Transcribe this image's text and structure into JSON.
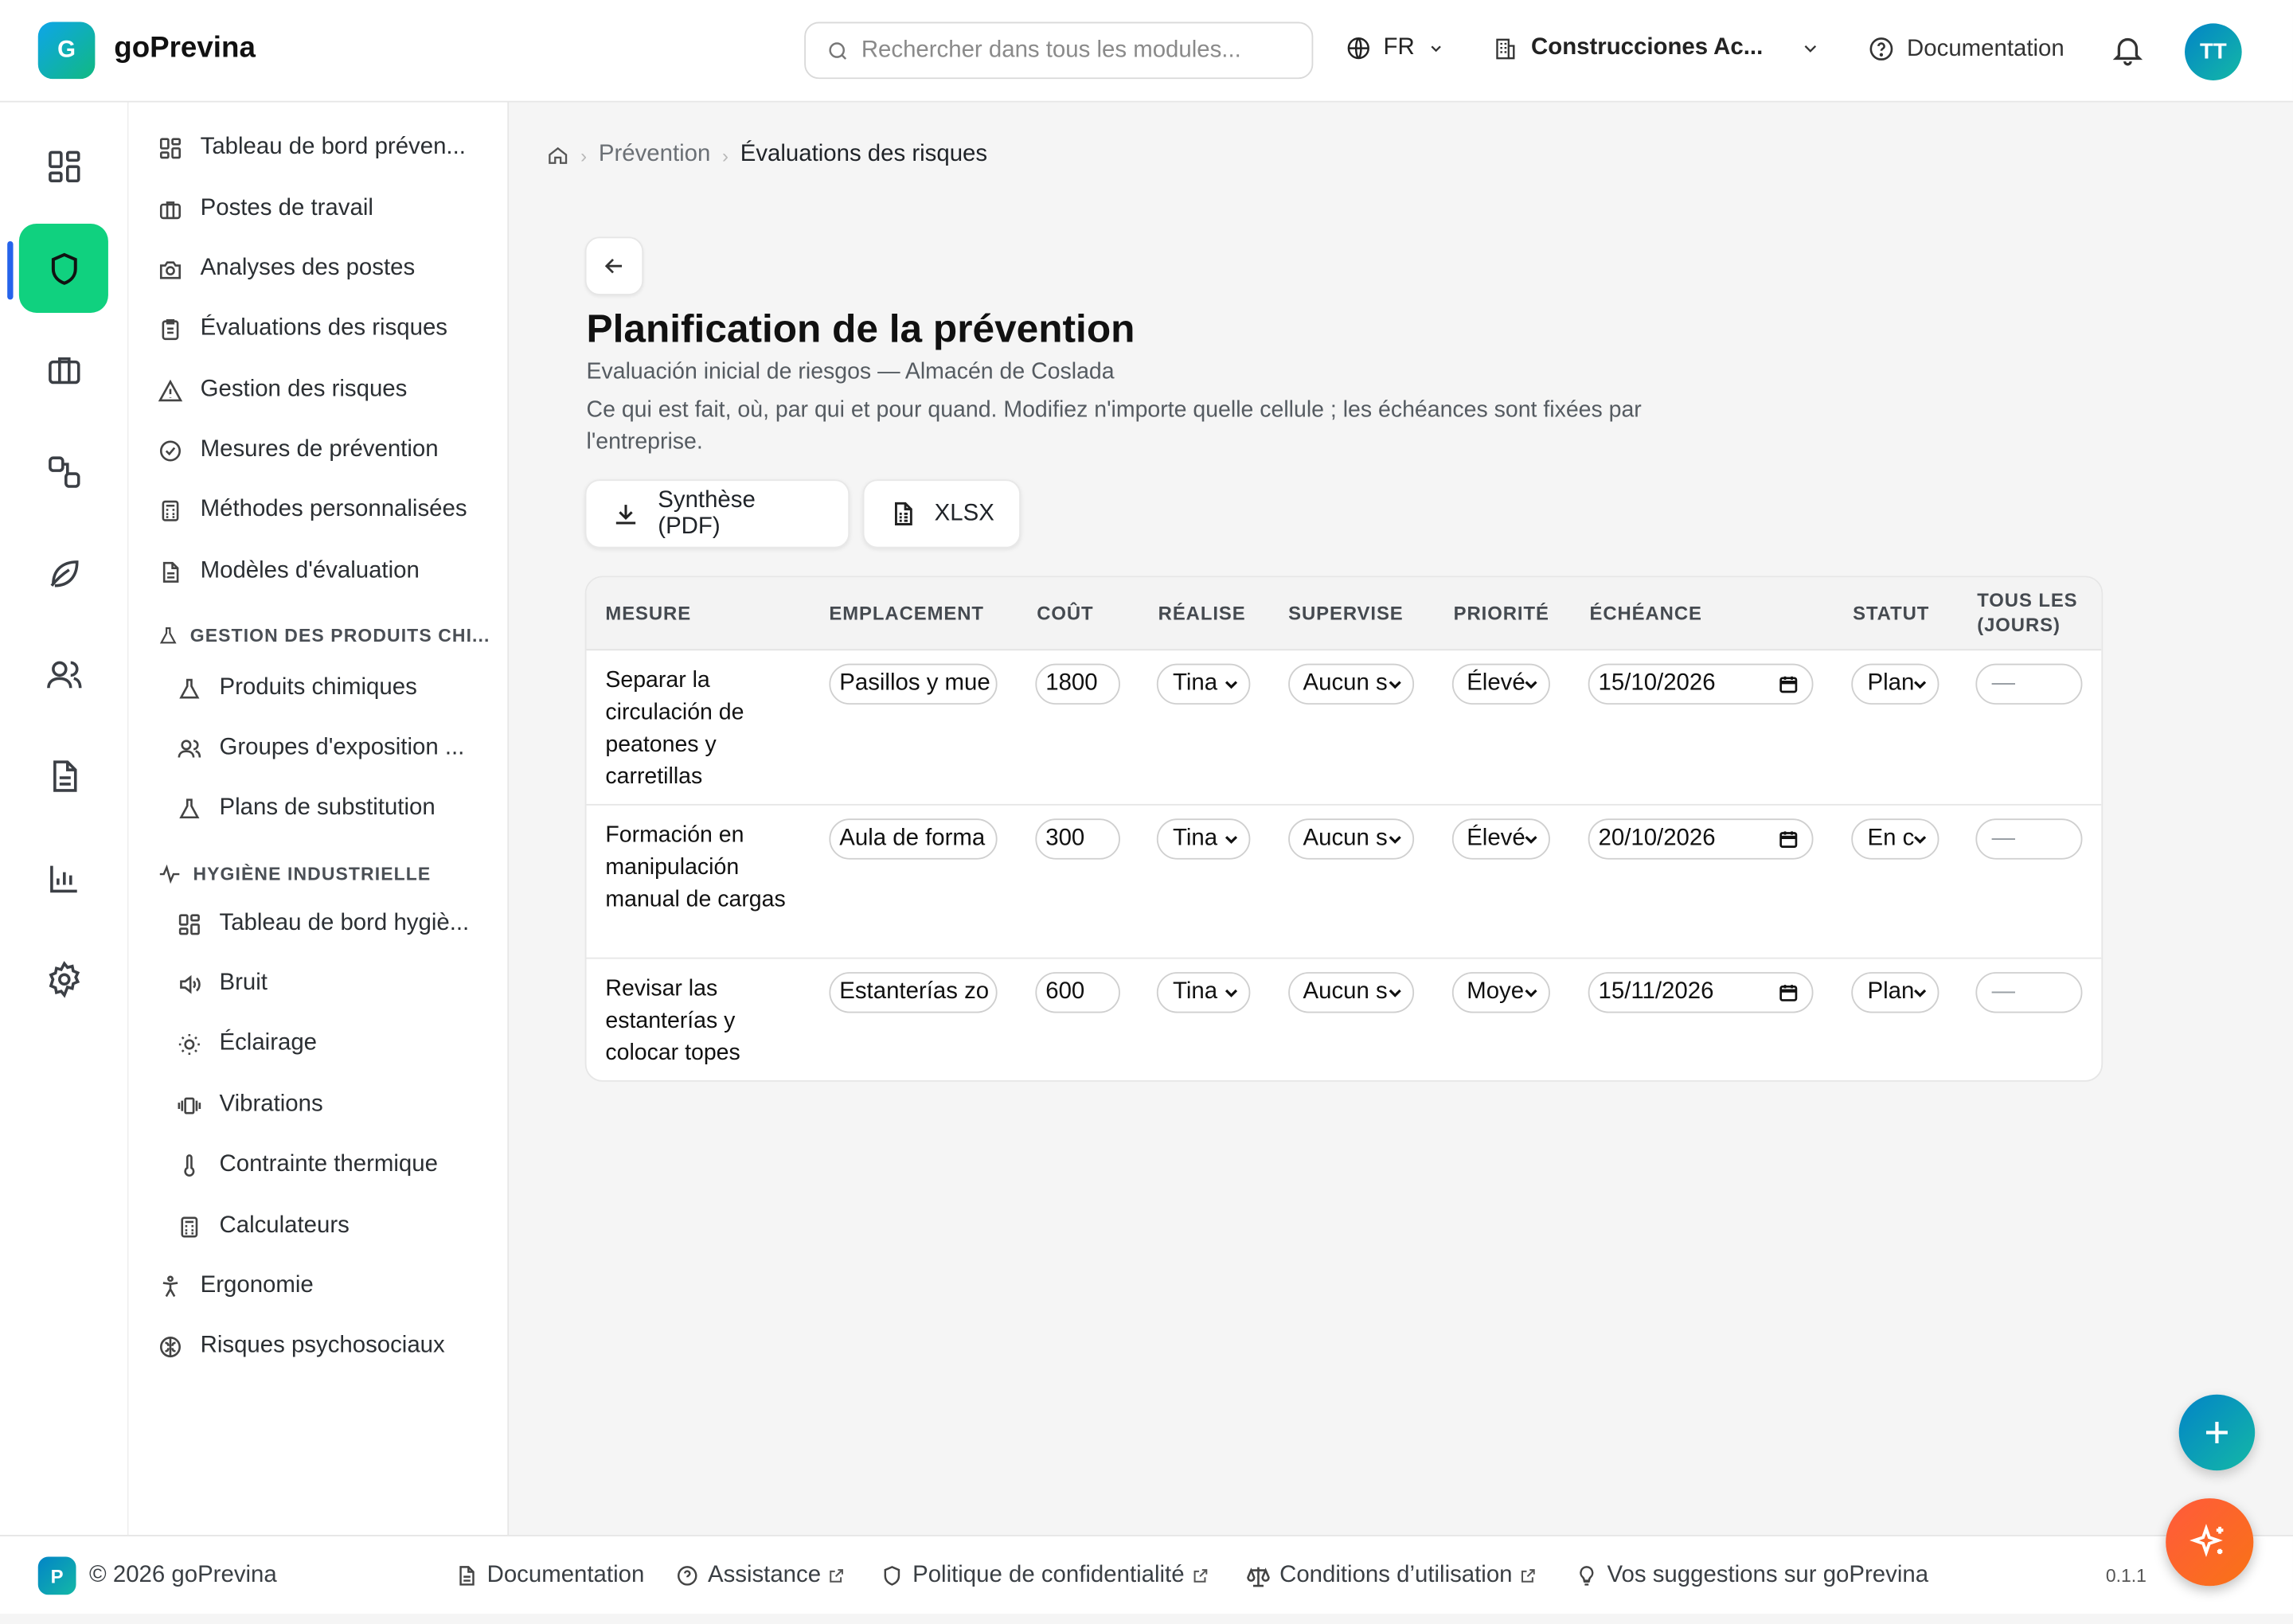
{
  "app": {
    "logo_letter": "G",
    "name": "goPrevina"
  },
  "header": {
    "search_placeholder": "Rechercher dans tous les modules...",
    "language": "FR",
    "company": "Construcciones Ac...",
    "documentation": "Documentation",
    "user_initials": "TT"
  },
  "sidebar": {
    "items": [
      {
        "label": "Tableau de bord préven...",
        "icon": "dashboard-icon"
      },
      {
        "label": "Postes de travail",
        "icon": "briefcase-icon"
      },
      {
        "label": "Analyses des postes",
        "icon": "camera-icon"
      },
      {
        "label": "Évaluations des risques",
        "icon": "clipboard-icon"
      },
      {
        "label": "Gestion des risques",
        "icon": "warning-icon"
      },
      {
        "label": "Mesures de prévention",
        "icon": "check-circle-icon"
      },
      {
        "label": "Méthodes personnalisées",
        "icon": "calculator-icon"
      },
      {
        "label": "Modèles d'évaluation",
        "icon": "document-icon"
      }
    ],
    "section_chem": "GESTION DES PRODUITS CHI...",
    "chem_items": [
      {
        "label": "Produits chimiques",
        "icon": "flask-icon"
      },
      {
        "label": "Groupes d'exposition ...",
        "icon": "users-icon"
      },
      {
        "label": "Plans de substitution",
        "icon": "flask-icon"
      }
    ],
    "section_hyg": "HYGIÈNE INDUSTRIELLE",
    "hyg_items": [
      {
        "label": "Tableau de bord hygiè...",
        "icon": "dashboard-icon"
      },
      {
        "label": "Bruit",
        "icon": "speaker-icon"
      },
      {
        "label": "Éclairage",
        "icon": "sun-icon"
      },
      {
        "label": "Vibrations",
        "icon": "vibration-icon"
      },
      {
        "label": "Contrainte thermique",
        "icon": "thermometer-icon"
      },
      {
        "label": "Calculateurs",
        "icon": "calculator-icon"
      }
    ],
    "bottom_items": [
      {
        "label": "Ergonomie",
        "icon": "person-icon"
      },
      {
        "label": "Risques psychosociaux",
        "icon": "brain-icon"
      }
    ]
  },
  "breadcrumb": {
    "level1": "Prévention",
    "level2": "Évaluations des risques"
  },
  "page": {
    "title": "Planification de la prévention",
    "subtitle": "Evaluación inicial de riesgos — Almacén de Coslada",
    "description": "Ce qui est fait, où, par qui et pour quand. Modifiez n'importe quelle cellule ; les échéances sont fixées par l'entreprise.",
    "export_pdf": "Synthèse (PDF)",
    "export_xlsx": "XLSX"
  },
  "table": {
    "columns": [
      "MESURE",
      "EMPLACEMENT",
      "COÛT",
      "RÉALISE",
      "SUPERVISE",
      "PRIORITÉ",
      "ÉCHÉANCE",
      "STATUT",
      "TOUS LES",
      "(JOURS)"
    ],
    "rows": [
      {
        "measure": "Separar la circulación de peatones y carretillas",
        "location": "Pasillos y mue",
        "cost": "1800",
        "performer": "Tina",
        "supervisor": "Aucun s",
        "priority": "Élevé",
        "deadline": "15/10/2026",
        "status": "Plan",
        "every_days": "—"
      },
      {
        "measure": "Formación en manipulación manual de cargas",
        "location": "Aula de forma",
        "cost": "300",
        "performer": "Tina",
        "supervisor": "Aucun s",
        "priority": "Élevé",
        "deadline": "20/10/2026",
        "status": "En c",
        "every_days": "—"
      },
      {
        "measure": "Revisar las estanterías y colocar topes",
        "location": "Estanterías zo",
        "cost": "600",
        "performer": "Tina",
        "supervisor": "Aucun s",
        "priority": "Moye",
        "deadline": "15/11/2026",
        "status": "Plan",
        "every_days": "—"
      }
    ]
  },
  "footer": {
    "badge": "P",
    "copyright": "© 2026 goPrevina",
    "documentation": "Documentation",
    "assistance": "Assistance",
    "privacy": "Politique de confidentialité",
    "terms": "Conditions d’utilisation",
    "suggestions": "Vos suggestions sur goPrevina",
    "version": "0.1.1"
  },
  "colors": {
    "accent_green": "#10d17f",
    "brand_blue": "#0284c7",
    "ai_orange": "#ff5a3c"
  }
}
